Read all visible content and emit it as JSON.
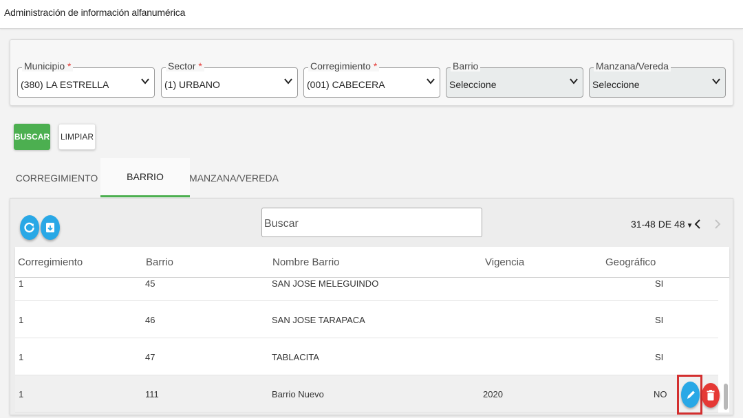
{
  "header": {
    "title": "Administración de información alfanumérica"
  },
  "filters": {
    "required_mark": "*",
    "municipio": {
      "label": "Municipio",
      "value": "(380) LA ESTRELLA"
    },
    "sector": {
      "label": "Sector",
      "value": "(1) URBANO"
    },
    "corregimiento": {
      "label": "Corregimiento",
      "value": "(001) CABECERA"
    },
    "barrio": {
      "label": "Barrio",
      "value": "Seleccione"
    },
    "manzana": {
      "label": "Manzana/Vereda",
      "value": "Seleccione"
    }
  },
  "actions": {
    "buscar": "BUSCAR",
    "limpiar": "LIMPIAR"
  },
  "tabs": [
    {
      "label": "CORREGIMIENTO",
      "active": false
    },
    {
      "label": "BARRIO",
      "active": true
    },
    {
      "label": "MANZANA/VEREDA",
      "active": false
    }
  ],
  "table": {
    "search_placeholder": "Buscar",
    "pagination": "31-48 DE 48",
    "columns": [
      "Corregimiento",
      "Barrio",
      "Nombre Barrio",
      "Vigencia",
      "Geográfico"
    ],
    "rows": [
      {
        "corregimiento": "1",
        "barrio": "45",
        "nombre": "SAN JOSE MELEGUINDO",
        "vigencia": "",
        "geografico": "SI"
      },
      {
        "corregimiento": "1",
        "barrio": "46",
        "nombre": "SAN JOSE TARAPACA",
        "vigencia": "",
        "geografico": "SI"
      },
      {
        "corregimiento": "1",
        "barrio": "47",
        "nombre": "TABLACITA",
        "vigencia": "",
        "geografico": "SI"
      },
      {
        "corregimiento": "1",
        "barrio": "111",
        "nombre": "Barrio Nuevo",
        "vigencia": "2020",
        "geografico": "NO"
      }
    ]
  },
  "icons": {
    "refresh": "refresh-icon",
    "export": "export-icon",
    "edit": "pencil-icon",
    "delete": "trash-icon"
  },
  "colors": {
    "accent_green": "#4caf50",
    "action_blue": "#29a8e6",
    "delete_red": "#e53935",
    "highlight_red": "#d32f2f"
  }
}
